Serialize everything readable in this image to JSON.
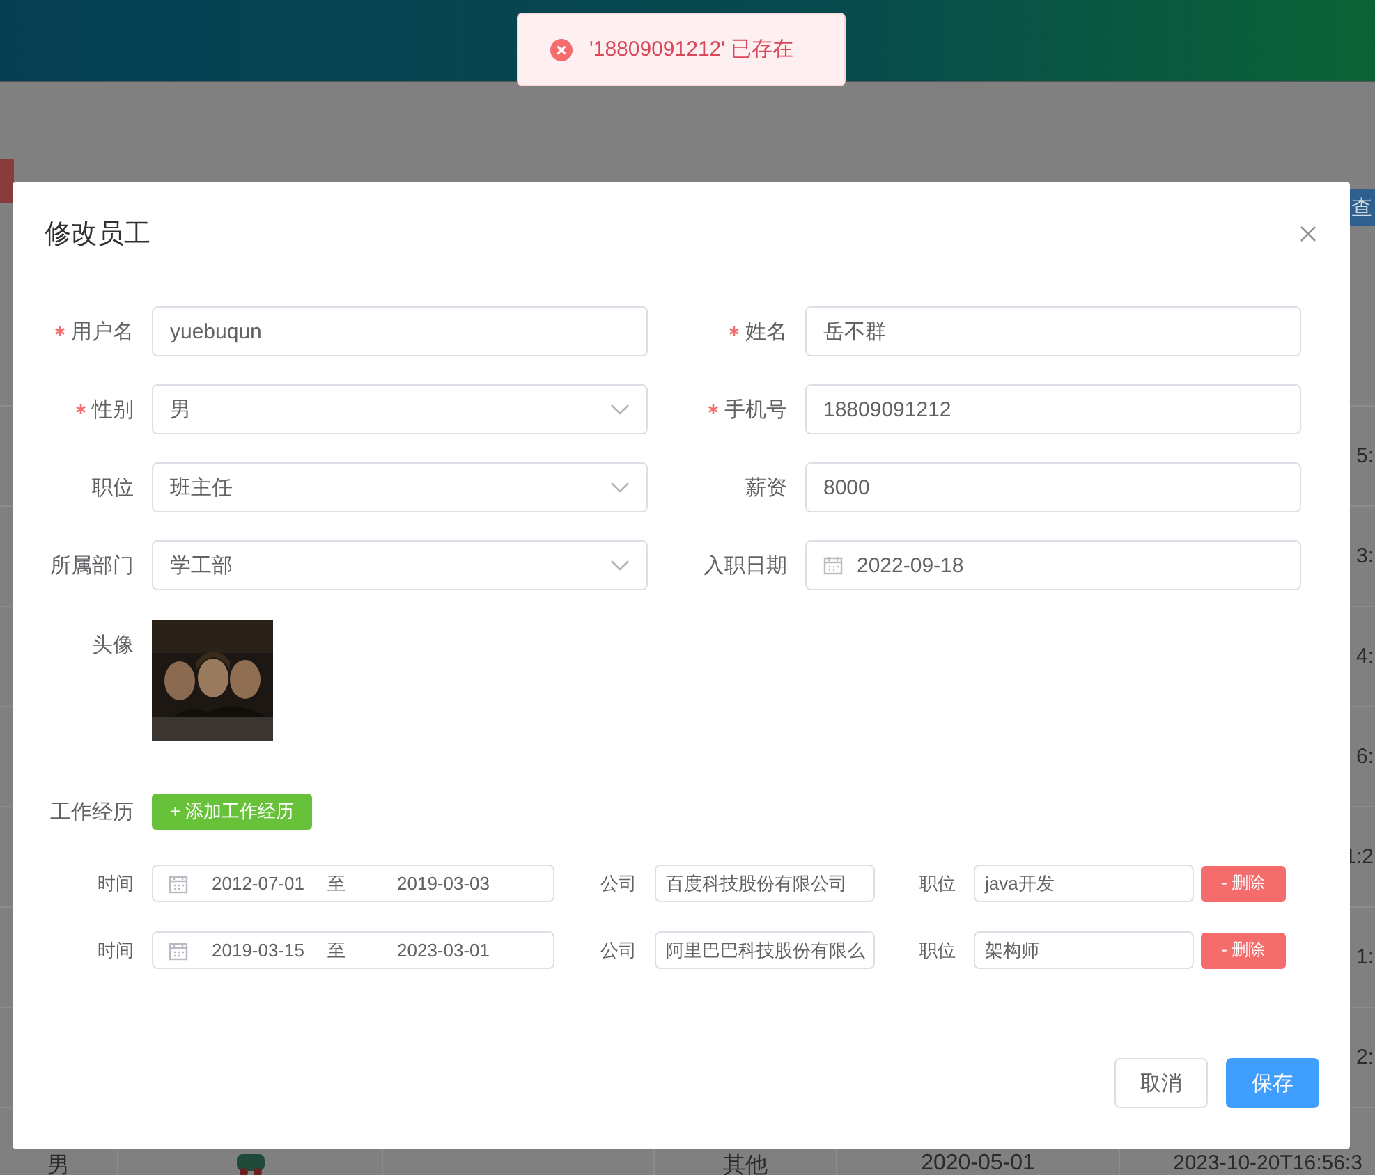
{
  "background": {
    "search_button": "查",
    "time_fragments": [
      "5:",
      "3:",
      "4:",
      "6:",
      "1:2",
      "1:",
      "2:"
    ],
    "last_row": {
      "gender": "男",
      "position": "其他",
      "entry_date": "2020-05-01",
      "updated": "2023-10-20T16:56:3"
    }
  },
  "toast": {
    "message": "'18809091212' 已存在"
  },
  "dialog": {
    "title": "修改员工",
    "fields": [
      {
        "label": "用户名",
        "required": true,
        "value": "yuebuqun",
        "kind": "text"
      },
      {
        "label": "姓名",
        "required": true,
        "value": "岳不群",
        "kind": "text"
      },
      {
        "label": "性别",
        "required": true,
        "value": "男",
        "kind": "select"
      },
      {
        "label": "手机号",
        "required": true,
        "value": "18809091212",
        "kind": "text"
      },
      {
        "label": "职位",
        "required": false,
        "value": "班主任",
        "kind": "select"
      },
      {
        "label": "薪资",
        "required": false,
        "value": "8000",
        "kind": "text"
      },
      {
        "label": "所属部门",
        "required": false,
        "value": "学工部",
        "kind": "select"
      },
      {
        "label": "入职日期",
        "required": false,
        "value": "2022-09-18",
        "kind": "date"
      }
    ],
    "avatar": {
      "label": "头像",
      "kind": "picture"
    },
    "experience": {
      "label": "工作经历",
      "add_button": "+ 添加工作经历",
      "rows": [
        {
          "time_label": "时间",
          "start": "2012-07-01",
          "separator": "至",
          "end": "2019-03-03",
          "company_label": "公司",
          "company": "百度科技股份有限公司",
          "position_label": "职位",
          "position": "java开发",
          "delete_button": "- 删除"
        },
        {
          "time_label": "时间",
          "start": "2019-03-15",
          "separator": "至",
          "end": "2023-03-01",
          "company_label": "公司",
          "company": "阿里巴巴科技股份有限么",
          "position_label": "职位",
          "position": "架构师",
          "delete_button": "- 删除"
        }
      ]
    },
    "buttons": {
      "cancel": "取消",
      "save": "保存"
    }
  }
}
